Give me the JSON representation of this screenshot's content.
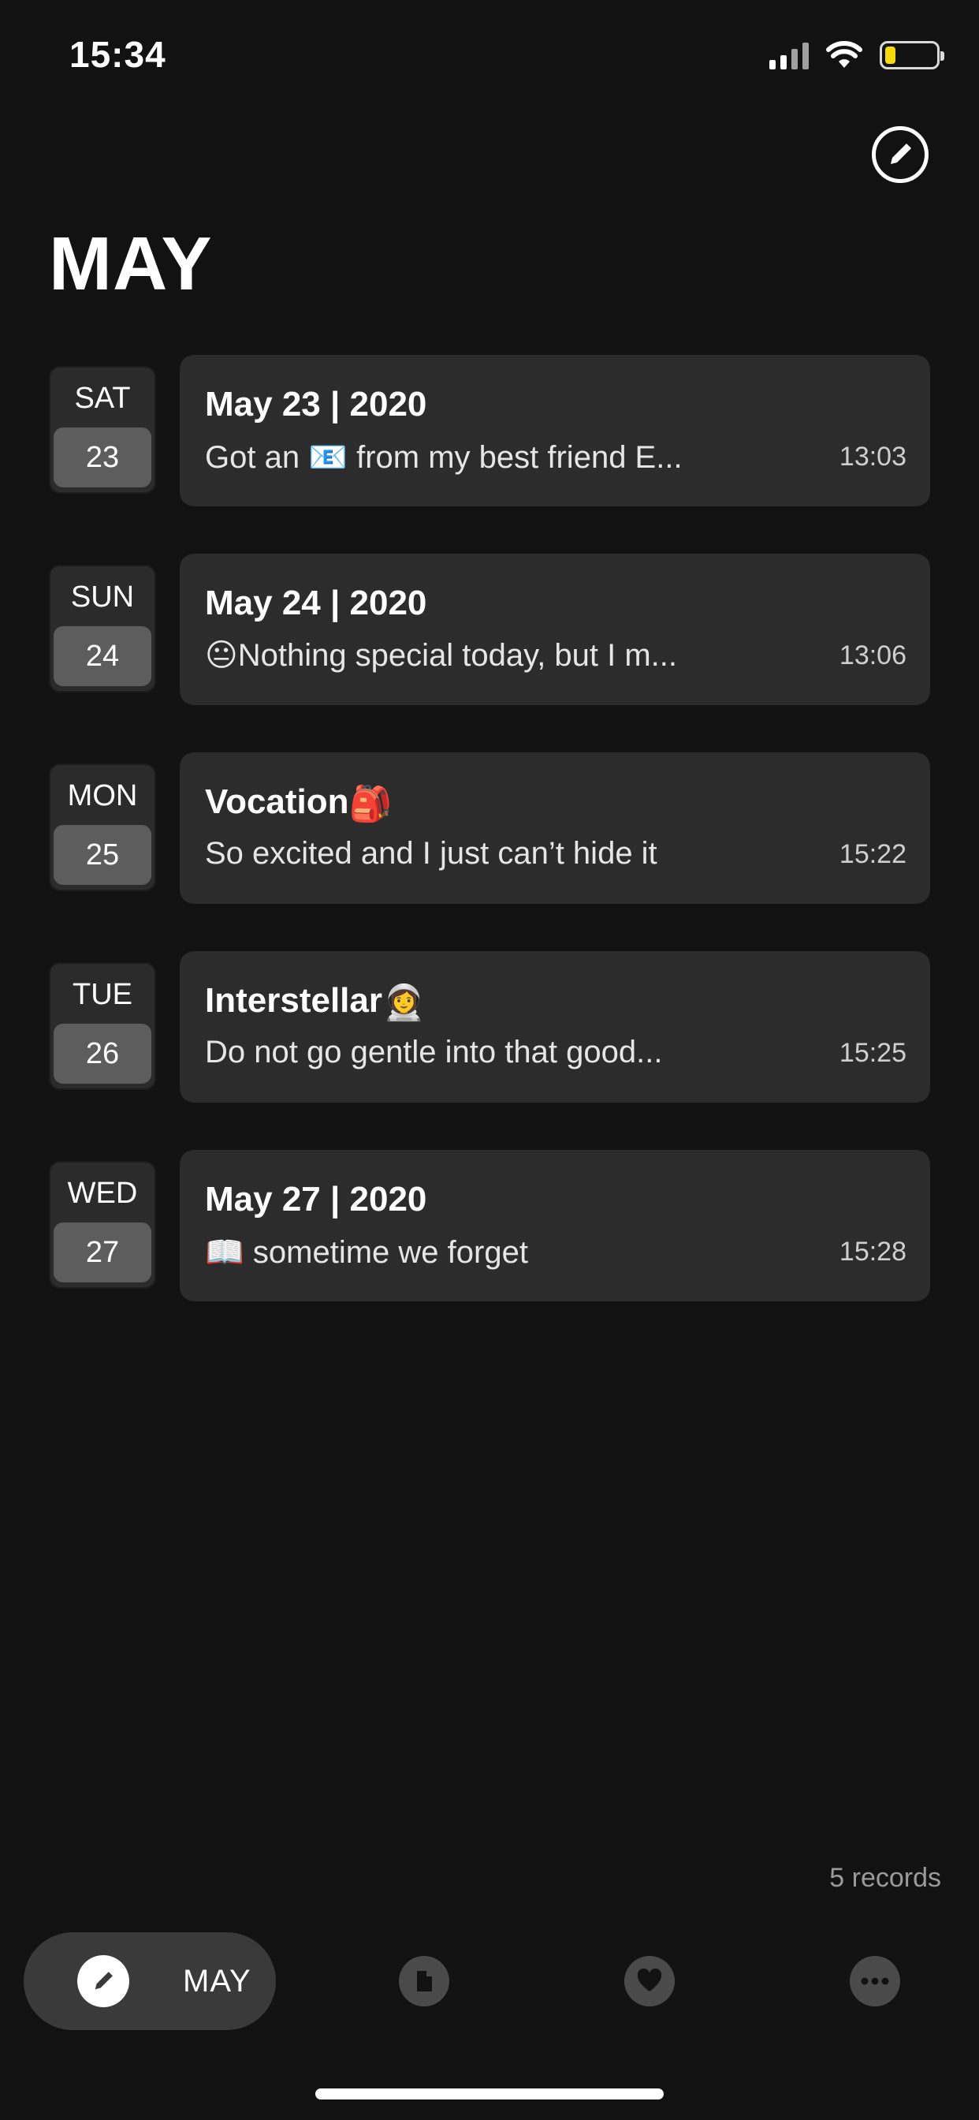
{
  "status_bar": {
    "time": "15:34"
  },
  "header": {
    "month_title": "MAY"
  },
  "entries": [
    {
      "dow": "SAT",
      "day": "23",
      "title": "May 23 | 2020",
      "title_emoji": "",
      "snippet": "Got an 📧 from my best friend E...",
      "time": "13:03"
    },
    {
      "dow": "SUN",
      "day": "24",
      "title": "May 24 | 2020",
      "title_emoji": "",
      "snippet": "😐Nothing special today, but I m...",
      "time": "13:06"
    },
    {
      "dow": "MON",
      "day": "25",
      "title": "Vocation",
      "title_emoji": "🎒",
      "snippet": "So excited and I just can’t hide it",
      "time": "15:22"
    },
    {
      "dow": "TUE",
      "day": "26",
      "title": "Interstellar",
      "title_emoji": "👩‍🚀",
      "snippet": "Do not go gentle into that good...",
      "time": "15:25"
    },
    {
      "dow": "WED",
      "day": "27",
      "title": "May 27 | 2020",
      "title_emoji": "",
      "snippet": "📖 sometime we forget",
      "time": "15:28"
    }
  ],
  "footer": {
    "records": "5 records"
  },
  "bottom_nav": {
    "active_label": "MAY",
    "icons": [
      "compose-icon",
      "document-icon",
      "heart-icon",
      "more-icon"
    ]
  },
  "colors": {
    "background": "#121212",
    "card": "#2c2c2c",
    "date_box": "#2b2b2b",
    "day_badge": "#5d5d5d",
    "battery": "#f5d90a"
  },
  "battery_level": 0.2
}
